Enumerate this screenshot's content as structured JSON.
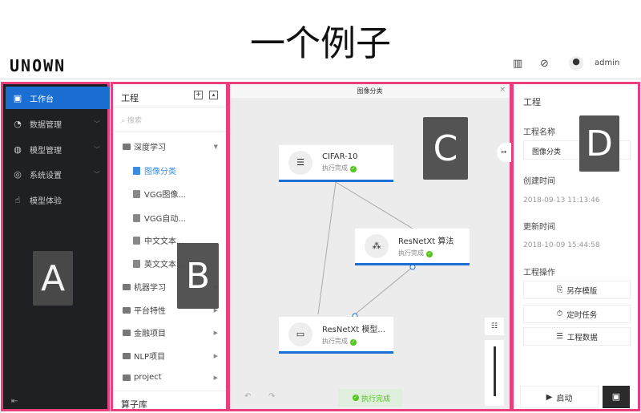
{
  "page_title": "一个例子",
  "header": {
    "logo": "UNOWN",
    "icons": [
      "bar-chart-icon",
      "activity-icon",
      "user-avatar-icon"
    ],
    "user": "admin"
  },
  "sidebar": {
    "items": [
      {
        "label": "工作台",
        "icon": "monitor-icon",
        "active": true
      },
      {
        "label": "数据管理",
        "icon": "pie-chart-icon"
      },
      {
        "label": "模型管理",
        "icon": "globe-icon"
      },
      {
        "label": "系统设置",
        "icon": "settings-icon"
      },
      {
        "label": "模型体验",
        "icon": "hand-icon"
      }
    ],
    "collapse_icon": "collapse-icon"
  },
  "project_panel": {
    "title": "工程",
    "search_placeholder": "搜索",
    "tree": [
      {
        "label": "深度学习",
        "type": "folder",
        "expanded": true
      },
      {
        "label": "图像分类",
        "type": "doc",
        "selected": true
      },
      {
        "label": "VGG图像...",
        "type": "doc"
      },
      {
        "label": "VGG自动...",
        "type": "doc"
      },
      {
        "label": "中文文本...",
        "type": "doc"
      },
      {
        "label": "英文文本...",
        "type": "doc"
      },
      {
        "label": "机器学习",
        "type": "folder"
      },
      {
        "label": "平台特性",
        "type": "folder"
      },
      {
        "label": "金融项目",
        "type": "folder"
      },
      {
        "label": "NLP项目",
        "type": "folder"
      },
      {
        "label": "project",
        "type": "folder"
      }
    ],
    "operator_library": "算子库"
  },
  "canvas": {
    "title": "图像分类",
    "status": "执行完成",
    "nodes": [
      {
        "name": "CIFAR-10",
        "status": "执行完成",
        "icon": "layers-icon"
      },
      {
        "name": "ResNetXt 算法",
        "status": "执行完成",
        "icon": "cluster-icon"
      },
      {
        "name": "ResNetXt 模型...",
        "status": "执行完成",
        "icon": "window-icon"
      }
    ]
  },
  "details": {
    "title": "工程",
    "name_label": "工程名称",
    "name_value": "图像分类",
    "created_label": "创建时间",
    "created_value": "2018-09-13 11:13:46",
    "updated_label": "更新时间",
    "updated_value": "2018-10-09 15:44:58",
    "ops_label": "工程操作",
    "ops": [
      "另存模版",
      "定时任务",
      "工程数据"
    ],
    "start": "启动"
  },
  "overlays": {
    "a": "A",
    "b": "B",
    "c": "C",
    "d": "D"
  },
  "colors": {
    "accent": "#1b6fd3",
    "highlight_border": "#ea3f7c",
    "success": "#52c41a",
    "sidebar_bg": "#1f2024"
  }
}
